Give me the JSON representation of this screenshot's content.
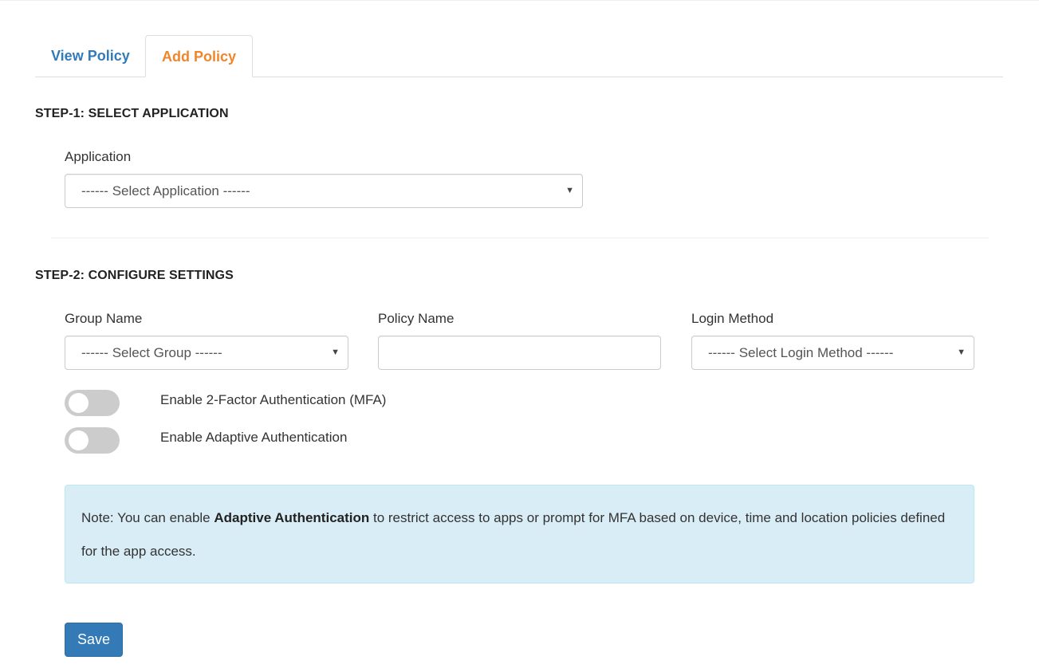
{
  "tabs": [
    {
      "label": "View Policy",
      "active": false
    },
    {
      "label": "Add Policy",
      "active": true
    }
  ],
  "step1": {
    "title": "STEP-1: SELECT APPLICATION",
    "application_label": "Application",
    "application_selected": "------ Select Application ------"
  },
  "step2": {
    "title": "STEP-2: CONFIGURE SETTINGS",
    "group_label": "Group Name",
    "group_selected": "------ Select Group ------",
    "policy_label": "Policy Name",
    "policy_value": "",
    "login_label": "Login Method",
    "login_selected": "------ Select Login Method ------",
    "toggle_mfa_label": "Enable 2-Factor Authentication (MFA)",
    "toggle_mfa_on": false,
    "toggle_adaptive_label": "Enable Adaptive Authentication",
    "toggle_adaptive_on": false
  },
  "note": {
    "prefix": "Note: You can enable ",
    "bold": "Adaptive Authentication",
    "suffix": " to restrict access to apps or prompt for MFA based on device, time and location policies defined for the app access."
  },
  "save_label": "Save",
  "colors": {
    "tab_link": "#337ab7",
    "tab_active": "#f0862a",
    "note_bg": "#d9edf7",
    "save_bg": "#337ab7"
  }
}
